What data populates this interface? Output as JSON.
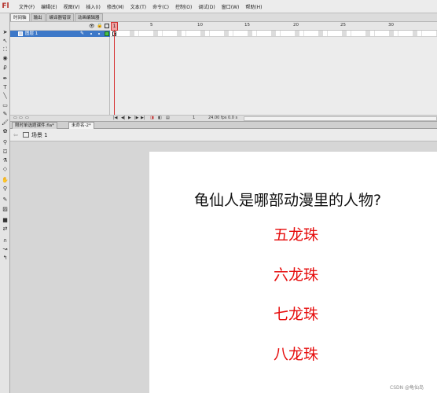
{
  "app": {
    "logo": "Fl"
  },
  "menu": {
    "items": [
      "文件(F)",
      "编辑(E)",
      "视图(V)",
      "插入(I)",
      "修改(M)",
      "文本(T)",
      "命令(C)",
      "控制(O)",
      "调试(D)",
      "窗口(W)",
      "帮助(H)"
    ]
  },
  "panel_tabs": [
    "时间轴",
    "输出",
    "编译器错误",
    "动画编辑器"
  ],
  "timeline": {
    "layer_name": "图层 1",
    "ruler_labels": [
      "1",
      "5",
      "10",
      "15",
      "20",
      "25",
      "30"
    ],
    "playhead_frame": "1",
    "status": {
      "frame": "1",
      "fps": "24.00 fps",
      "time": "0.0 s"
    }
  },
  "document_tabs": [
    "限时单选题课件.fla*",
    "未命名-2*"
  ],
  "breadcrumb": {
    "scene": "场景 1"
  },
  "stage": {
    "question": "龟仙人是哪部动漫里的人物?",
    "answers": [
      "五龙珠",
      "六龙珠",
      "七龙珠",
      "八龙珠"
    ]
  },
  "watermark": "CSDN @龟仙岛",
  "colors": {
    "answer": "#e60d0d",
    "layer_selected": "#3d78c8",
    "playhead": "#d63030"
  }
}
